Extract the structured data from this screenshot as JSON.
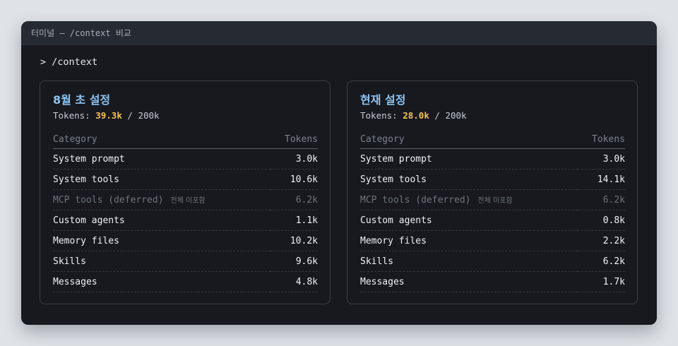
{
  "window": {
    "title": "터미널 — /context 비교"
  },
  "prompt": {
    "symbol": ">",
    "command": "/context"
  },
  "panels": [
    {
      "title": "8월 초 설정",
      "tokens_label": "Tokens: ",
      "used": "39.3k",
      "separator": " / ",
      "total": "200k",
      "col_category": "Category",
      "col_tokens": "Tokens",
      "rows": [
        {
          "category": "System prompt",
          "tokens": "3.0k"
        },
        {
          "category": "System tools",
          "tokens": "10.6k"
        },
        {
          "category": "MCP tools (deferred)",
          "note": "전체 미포함",
          "tokens": "6.2k"
        },
        {
          "category": "Custom agents",
          "tokens": "1.1k"
        },
        {
          "category": "Memory files",
          "tokens": "10.2k"
        },
        {
          "category": "Skills",
          "tokens": "9.6k"
        },
        {
          "category": "Messages",
          "tokens": "4.8k"
        }
      ]
    },
    {
      "title": "현재 설정",
      "tokens_label": "Tokens: ",
      "used": "28.0k",
      "separator": " / ",
      "total": "200k",
      "col_category": "Category",
      "col_tokens": "Tokens",
      "rows": [
        {
          "category": "System prompt",
          "tokens": "3.0k"
        },
        {
          "category": "System tools",
          "tokens": "14.1k"
        },
        {
          "category": "MCP tools (deferred)",
          "note": "전체 미포함",
          "tokens": "6.2k"
        },
        {
          "category": "Custom agents",
          "tokens": "0.8k"
        },
        {
          "category": "Memory files",
          "tokens": "2.2k"
        },
        {
          "category": "Skills",
          "tokens": "6.2k"
        },
        {
          "category": "Messages",
          "tokens": "1.7k"
        }
      ]
    }
  ],
  "colors": {
    "accent_title": "#8cc2f0",
    "used_tokens": "#f5c451",
    "terminal_bg": "#17191e"
  }
}
